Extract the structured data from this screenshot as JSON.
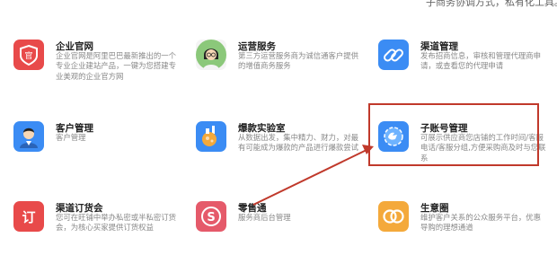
{
  "top_snippet": "子商务协调方式，私有化工具。",
  "colors": {
    "red": "#e84a4a",
    "blue": "#3b8cf4",
    "orange": "#f4a93b",
    "pink": "#e55a6a",
    "highlight": "#c0392b"
  },
  "cards": [
    {
      "title": "企业官网",
      "desc": "企业官网是阿里巴巴最新推出的一个专业企业建站产品，一键为您搭建专业美观的企业官方网",
      "icon": "official-site-icon"
    },
    {
      "title": "运营服务",
      "desc": "第三方运营服务商为诚信通客户提供的增值商务服务",
      "icon": "operator-avatar-icon"
    },
    {
      "title": "渠道管理",
      "desc": "发布招商信息，审核和管理代理商申请，或查看您的代理申请",
      "icon": "channel-link-icon"
    },
    {
      "title": "客户管理",
      "desc": "客户管理",
      "icon": "customer-avatar-icon"
    },
    {
      "title": "爆款实验室",
      "desc": "从数据出发，集中精力、财力，对最有可能成为爆款的产品进行爆款尝试",
      "icon": "lab-flask-icon"
    },
    {
      "title": "子账号管理",
      "desc": "可展示供应商您店铺的工作时间/客服电话/客服分组,方便采购商及时与您联系",
      "icon": "sub-account-icon"
    },
    {
      "title": "渠道订货会",
      "desc": "您可在旺铺中举办私密或半私密订货会，为核心买家提供订货权益",
      "icon": "order-fair-icon"
    },
    {
      "title": "零售通",
      "desc": "服务商后台管理",
      "icon": "retail-s-icon"
    },
    {
      "title": "生意圈",
      "desc": "维护客户关系的公众服务平台，优惠导购的理想通道",
      "icon": "business-circle-icon"
    }
  ]
}
